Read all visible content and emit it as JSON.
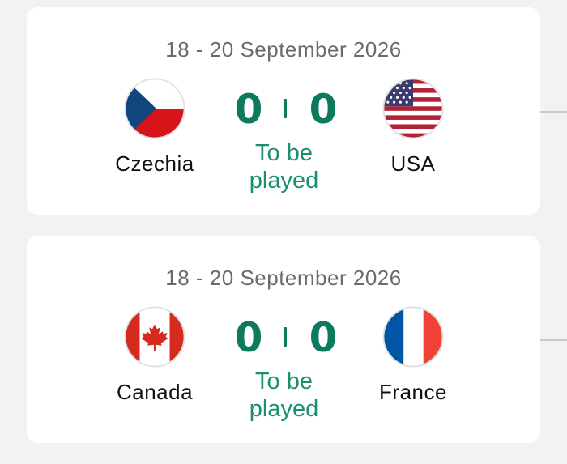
{
  "colors": {
    "accent": "#0c7a5c",
    "status": "#1a9070",
    "card": "#ffffff",
    "background": "#f2f2f2"
  },
  "matches": [
    {
      "date": "18 - 20 September 2026",
      "home": {
        "name": "Czechia",
        "flag_icon": "czech-flag-icon",
        "score": "0"
      },
      "away": {
        "name": "USA",
        "flag_icon": "usa-flag-icon",
        "score": "0"
      },
      "status_line1": "To be",
      "status_line2": "played"
    },
    {
      "date": "18 - 20 September 2026",
      "home": {
        "name": "Canada",
        "flag_icon": "canada-flag-icon",
        "score": "0"
      },
      "away": {
        "name": "France",
        "flag_icon": "france-flag-icon",
        "score": "0"
      },
      "status_line1": "To be",
      "status_line2": "played"
    }
  ]
}
